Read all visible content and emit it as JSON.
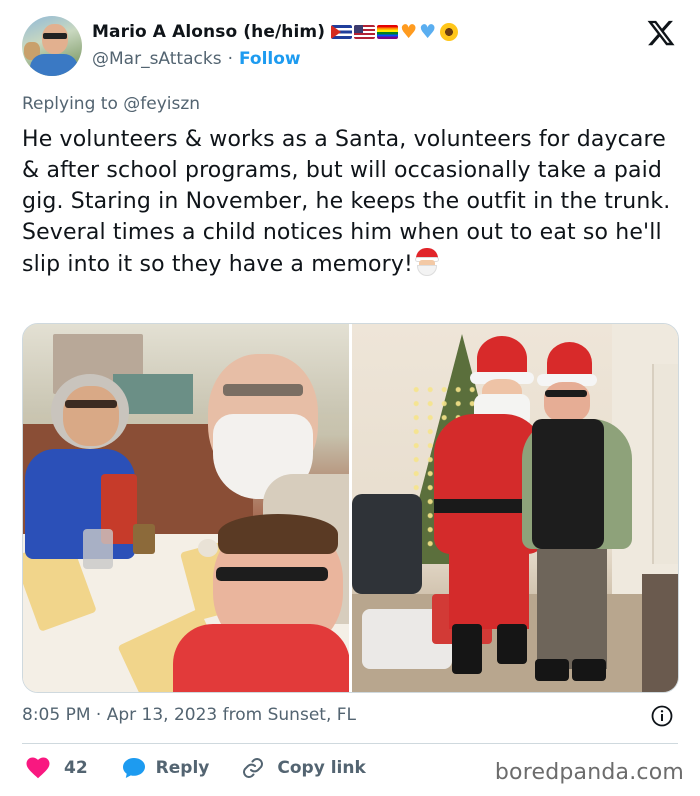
{
  "author": {
    "display_name": "Mario A Alonso (he/him)",
    "handle": "@Mar_sAttacks",
    "separator": "·",
    "follow_label": "Follow",
    "avatar_icon": "profile-photo",
    "name_emojis": [
      "flag-cuba-icon",
      "flag-usa-icon",
      "rainbow-flag-icon",
      "orange-heart-icon",
      "blue-heart-icon",
      "sunflower-icon"
    ]
  },
  "platform": {
    "logo_icon": "x-logo-icon"
  },
  "reply_context": {
    "prefix": "Replying to",
    "handle": "@feyiszn"
  },
  "tweet": {
    "text": "He volunteers & works as a Santa, volunteers for daycare & after school programs, but will occasionally take a paid gig. Staring in November, he keeps the outfit in the trunk. Several times a child notices him when out to eat so he'll slip into it so they have a memory!",
    "trailing_emoji": "santa-emoji-icon"
  },
  "media": {
    "images": [
      {
        "name": "restaurant-photo"
      },
      {
        "name": "christmas-tree-photo"
      }
    ]
  },
  "meta": {
    "time": "8:05 PM",
    "separator": "·",
    "date": "Apr 13, 2023",
    "source": "from Sunset, FL"
  },
  "actions": {
    "like_count": "42",
    "reply_label": "Reply",
    "copy_link_label": "Copy link"
  },
  "colors": {
    "accent": "#1d9bf0",
    "like": "#f91880",
    "secondary_text": "#536471",
    "primary_text": "#0f1419"
  },
  "watermark": "boredpanda.com"
}
